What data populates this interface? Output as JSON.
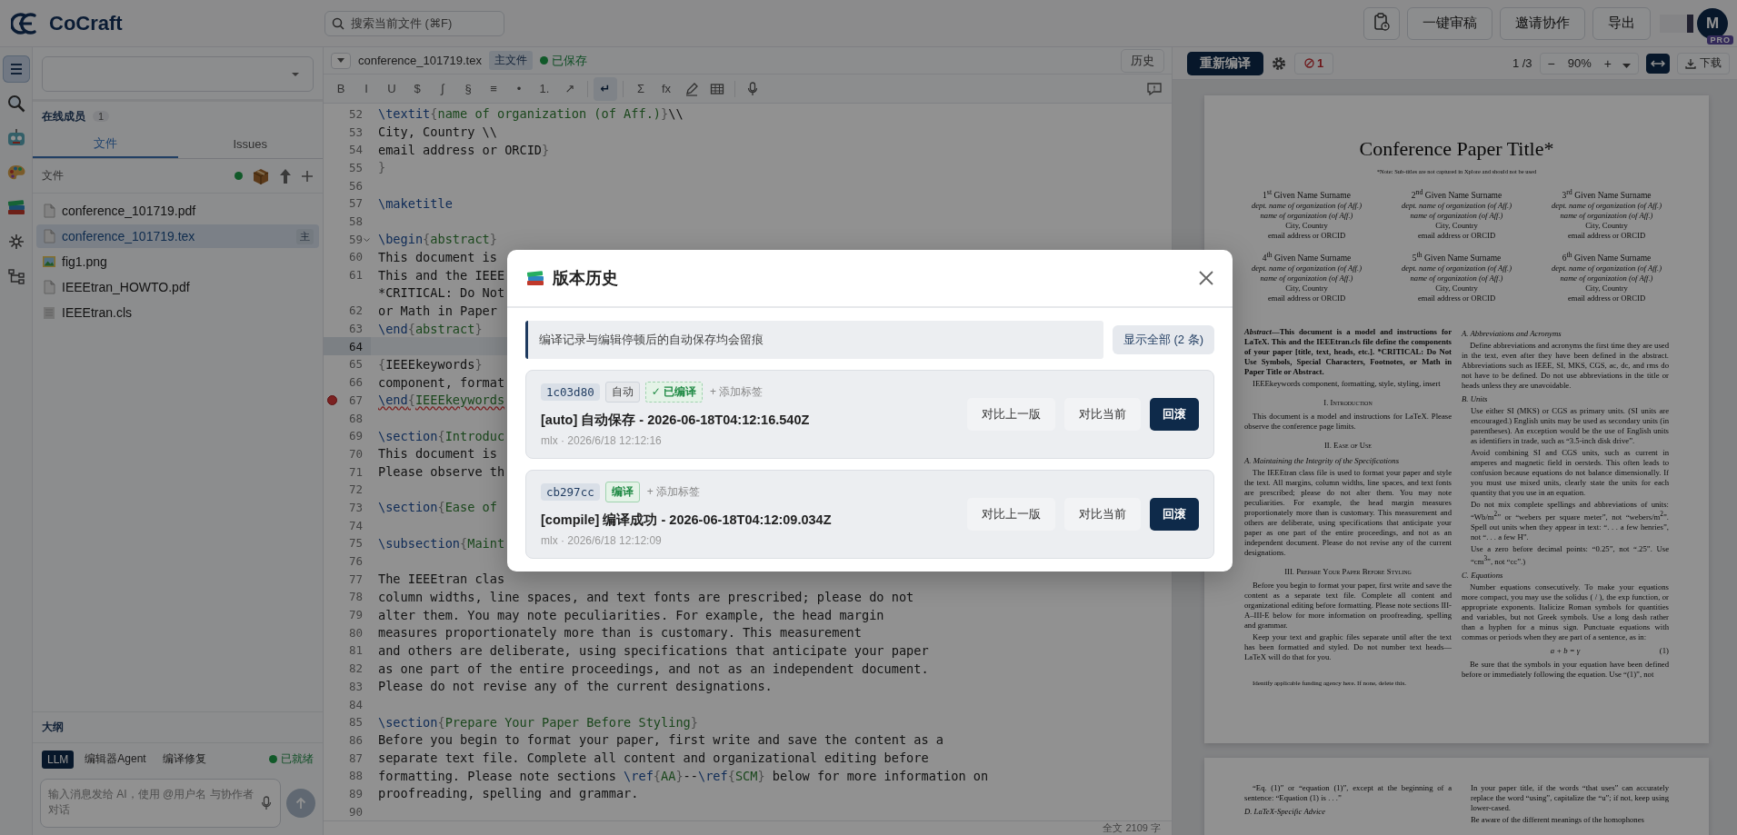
{
  "topbar": {
    "brand": "CoCraft",
    "search": {
      "placeholder": "搜索当前文件 (⌘F)"
    },
    "review_button": "一键审稿",
    "invite_button": "邀请协作",
    "export_button": "导出",
    "avatar": {
      "initial": "M",
      "badge": "PRO"
    }
  },
  "rail": [
    {
      "kind": "menu",
      "selected": true
    },
    {
      "kind": "search",
      "selected": false
    },
    {
      "kind": "robot",
      "selected": false
    },
    {
      "kind": "palette",
      "selected": false
    },
    {
      "kind": "books",
      "selected": false
    },
    {
      "kind": "sparkle",
      "selected": false
    },
    {
      "kind": "tree",
      "selected": false
    }
  ],
  "sidebar": {
    "members": {
      "label": "在线成员",
      "count": "1"
    },
    "tabs": [
      {
        "label": "文件",
        "selected": true
      },
      {
        "label": "Issues",
        "selected": false
      }
    ],
    "files_header": "文件",
    "files": [
      {
        "name": "conference_101719.pdf",
        "kind": "doc",
        "selected": false
      },
      {
        "name": "conference_101719.tex",
        "kind": "doc",
        "selected": true,
        "badge": "主"
      },
      {
        "name": "fig1.png",
        "kind": "image",
        "selected": false
      },
      {
        "name": "IEEEtran_HOWTO.pdf",
        "kind": "doc",
        "selected": false
      },
      {
        "name": "IEEEtran.cls",
        "kind": "plain",
        "selected": false
      }
    ],
    "outline_label": "大纲",
    "assistant_tabs": [
      {
        "label": "LLM",
        "selected": true
      },
      {
        "label": "编辑器Agent",
        "selected": false
      },
      {
        "label": "编译修复",
        "selected": false
      }
    ],
    "assistant_status": "已就绪",
    "chat": {
      "placeholder": "输入消息发给 AI，使用 @用户名 与协作者对话"
    }
  },
  "editor": {
    "file_name": "conference_101719.tex",
    "main_badge": "主文件",
    "save_status": "已保存",
    "history_button": "历史",
    "toolbar": [
      {
        "kind": "glyph",
        "label": "B",
        "selected": false
      },
      {
        "kind": "glyph",
        "label": "I",
        "selected": false
      },
      {
        "kind": "glyph",
        "label": "U",
        "selected": false
      },
      {
        "kind": "glyph",
        "label": "$",
        "selected": false
      },
      {
        "kind": "glyph",
        "label": "∫",
        "selected": false
      },
      {
        "kind": "glyph",
        "label": "§",
        "selected": false
      },
      {
        "kind": "glyph",
        "label": "≡",
        "selected": false
      },
      {
        "kind": "glyph",
        "label": "•",
        "selected": false
      },
      {
        "kind": "glyph",
        "label": "1.",
        "selected": false
      },
      {
        "kind": "glyph",
        "label": "↗",
        "selected": false
      },
      {
        "kind": "divider"
      },
      {
        "kind": "glyph",
        "label": "↵",
        "selected": true
      },
      {
        "kind": "divider"
      },
      {
        "kind": "glyph",
        "label": "Σ",
        "selected": false
      },
      {
        "kind": "glyph",
        "label": "fx",
        "selected": false
      },
      {
        "kind": "pen",
        "selected": false
      },
      {
        "kind": "table",
        "selected": false
      },
      {
        "kind": "divider"
      },
      {
        "kind": "mic",
        "selected": false
      }
    ],
    "lines": [
      {
        "n": "52",
        "kind": "plain",
        "text": "\\textit{name of organization (of Aff.)}\\\\"
      },
      {
        "n": "53",
        "kind": "plain",
        "text": "City, Country \\\\"
      },
      {
        "n": "54",
        "kind": "plain",
        "text": "email address or ORCID}"
      },
      {
        "n": "55",
        "kind": "plain",
        "text": "}"
      },
      {
        "n": "56",
        "kind": "plain"
      },
      {
        "n": "57",
        "kind": "plain",
        "text": "\\maketitle"
      },
      {
        "n": "58",
        "kind": "plain"
      },
      {
        "n": "59",
        "kind": "fold",
        "text": "\\begin{abstract}"
      },
      {
        "n": "60",
        "kind": "plain",
        "text": "This document is"
      },
      {
        "n": "61",
        "kind": "plain",
        "text": "This and the IEEE"
      },
      {
        "kind": "wrap",
        "text": "*CRITICAL: Do Not"
      },
      {
        "n": "62",
        "kind": "plain",
        "text": "or Math in Paper"
      },
      {
        "n": "63",
        "kind": "plain",
        "text": "\\end{abstract}"
      },
      {
        "n": "64",
        "kind": "active"
      },
      {
        "n": "65",
        "kind": "plain",
        "text": "{IEEEkeywords}"
      },
      {
        "n": "66",
        "kind": "plain",
        "text": "component, format"
      },
      {
        "n": "67",
        "kind": "error",
        "text": "\\end{IEEEkeywords"
      },
      {
        "n": "68",
        "kind": "plain"
      },
      {
        "n": "69",
        "kind": "plain",
        "text": "\\section{Introduc"
      },
      {
        "n": "70",
        "kind": "plain",
        "text": "This document is"
      },
      {
        "n": "71",
        "kind": "plain",
        "text": "Please observe th"
      },
      {
        "n": "72",
        "kind": "plain"
      },
      {
        "n": "73",
        "kind": "plain",
        "text": "\\section{Ease of"
      },
      {
        "n": "74",
        "kind": "plain"
      },
      {
        "n": "75",
        "kind": "plain",
        "text": "\\subsection{Maint"
      },
      {
        "n": "76",
        "kind": "plain"
      },
      {
        "n": "77",
        "kind": "plain",
        "text": "The IEEEtran clas"
      },
      {
        "n": "78",
        "kind": "plain",
        "text": "column widths, line spaces, and text fonts are prescribed; please do not"
      },
      {
        "n": "79",
        "kind": "plain",
        "text": "alter them. You may note peculiarities. For example, the head margin"
      },
      {
        "n": "80",
        "kind": "plain",
        "text": "measures proportionately more than is customary. This measurement"
      },
      {
        "n": "81",
        "kind": "plain",
        "text": "and others are deliberate, using specifications that anticipate your paper"
      },
      {
        "n": "82",
        "kind": "plain",
        "text": "as one part of the entire proceedings, and not as an independent document."
      },
      {
        "n": "83",
        "kind": "plain",
        "text": "Please do not revise any of the current designations."
      },
      {
        "n": "84",
        "kind": "plain"
      },
      {
        "n": "85",
        "kind": "plain",
        "text": "\\section{Prepare Your Paper Before Styling}"
      },
      {
        "n": "86",
        "kind": "plain",
        "text": "Before you begin to format your paper, first write and save the content as a"
      },
      {
        "n": "87",
        "kind": "plain",
        "text": "separate text file. Complete all content and organizational editing before"
      },
      {
        "n": "88",
        "kind": "plain",
        "text": "formatting. Please note sections \\ref{AA}--\\ref{SCM} below for more information on"
      },
      {
        "n": "89",
        "kind": "plain",
        "text": "proofreading, spelling and grammar."
      },
      {
        "n": "90",
        "kind": "plain"
      }
    ],
    "word_count": "全文 2109 字"
  },
  "preview": {
    "recompile_button": "重新编译",
    "error_count": "1",
    "page": "1",
    "page_total": "/3",
    "zoom_out": "−",
    "zoom": "90%",
    "zoom_in": "+",
    "fit_width_selected": true,
    "download_button": "下载",
    "page1": {
      "title": "Conference Paper Title*",
      "note": "*Note: Sub-titles are not captured in Xplore and should not be used",
      "authors": [
        {
          "name": "1$^{st}$ Given Name Surname",
          "dept": "dept. name of organization (of Aff.)",
          "org": "name of organization (of Aff.)",
          "city": "City, Country",
          "email": "email address or ORCID"
        },
        {
          "name": "2$^{nd}$ Given Name Surname",
          "dept": "dept. name of organization (of Aff.)",
          "org": "name of organization (of Aff.)",
          "city": "City, Country",
          "email": "email address or ORCID"
        },
        {
          "name": "3$^{rd}$ Given Name Surname",
          "dept": "dept. name of organization (of Aff.)",
          "org": "name of organization (of Aff.)",
          "city": "City, Country",
          "email": "email address or ORCID"
        },
        {
          "name": "4$^{th}$ Given Name Surname",
          "dept": "dept. name of organization (of Aff.)",
          "org": "name of organization (of Aff.)",
          "city": "City, Country",
          "email": "email address or ORCID"
        },
        {
          "name": "5$^{th}$ Given Name Surname",
          "dept": "dept. name of organization (of Aff.)",
          "org": "name of organization (of Aff.)",
          "city": "City, Country",
          "email": "email address or ORCID"
        },
        {
          "name": "6$^{th}$ Given Name Surname",
          "dept": "dept. name of organization (of Aff.)",
          "org": "name of organization (of Aff.)",
          "city": "City, Country",
          "email": "email address or ORCID"
        }
      ],
      "left": [
        {
          "kind": "abstract",
          "lead": "Abstract",
          "text": "—This document is a model and instructions for LaTeX. This and the IEEEtran.cls file define the components of your paper [title, text, heads, etc.]. *CRITICAL: Do Not Use Symbols, Special Characters, Footnotes, or Math in Paper Title or Abstract."
        },
        {
          "kind": "para",
          "text": "IEEEkeywords component, formatting, style, styling, insert"
        },
        {
          "kind": "heading",
          "text": "I. Introduction"
        },
        {
          "kind": "para",
          "text": "This document is a model and instructions for LaTeX. Please observe the conference page limits."
        },
        {
          "kind": "heading",
          "text": "II. Ease of Use"
        },
        {
          "kind": "subheading",
          "text": "A. Maintaining the Integrity of the Specifications"
        },
        {
          "kind": "para",
          "text": "The IEEEtran class file is used to format your paper and style the text. All margins, column widths, line spaces, and text fonts are prescribed; please do not alter them. You may note peculiarities. For example, the head margin measures proportionately more than is customary. This measurement and others are deliberate, using specifications that anticipate your paper as one part of the entire proceedings, and not as an independent document. Please do not revise any of the current designations."
        },
        {
          "kind": "heading",
          "text": "III. Prepare Your Paper Before Styling"
        },
        {
          "kind": "para",
          "text": "Before you begin to format your paper, first write and save the content as a separate text file. Complete all content and organizational editing before formatting. Please note sections III-A–III-E below for more information on proofreading, spelling and grammar."
        },
        {
          "kind": "para",
          "text": "Keep your text and graphic files separate until after the text has been formatted and styled. Do not number text heads—LaTeX will do that for you."
        },
        {
          "kind": "footnote",
          "text": "Identify applicable funding agency here. If none, delete this."
        }
      ],
      "right": [
        {
          "kind": "subheading",
          "text": "A. Abbreviations and Acronyms"
        },
        {
          "kind": "para",
          "text": "Define abbreviations and acronyms the first time they are used in the text, even after they have been defined in the abstract. Abbreviations such as IEEE, SI, MKS, CGS, ac, dc, and rms do not have to be defined. Do not use abbreviations in the title or heads unless they are unavoidable."
        },
        {
          "kind": "subheading",
          "text": "B. Units"
        },
        {
          "kind": "bullet",
          "text": "Use either SI (MKS) or CGS as primary units. (SI units are encouraged.) English units may be used as secondary units (in parentheses). An exception would be the use of English units as identifiers in trade, such as “3.5-inch disk drive”."
        },
        {
          "kind": "bullet",
          "text": "Avoid combining SI and CGS units, such as current in amperes and magnetic field in oersteds. This often leads to confusion because equations do not balance dimensionally. If you must use mixed units, clearly state the units for each quantity that you use in an equation."
        },
        {
          "kind": "bullet",
          "text": "Do not mix complete spellings and abbreviations of units: “Wb/m$^{2}$” or “webers per square meter”, not “webers/m$^{2}$”. Spell out units when they appear in text: “. . . a few henries”, not “. . . a few H”."
        },
        {
          "kind": "bullet",
          "text": "Use a zero before decimal points: “0.25”, not “.25”. Use “cm$^{3}$”, not “cc”.)"
        },
        {
          "kind": "subheading",
          "text": "C. Equations"
        },
        {
          "kind": "para",
          "text": "Number equations consecutively. To make your equations more compact, you may use the solidus ( / ), the exp function, or appropriate exponents. Italicize Roman symbols for quantities and variables, but not Greek symbols. Use a long dash rather than a hyphen for a minus sign. Punctuate equations with commas or periods when they are part of a sentence, as in:"
        },
        {
          "kind": "equation",
          "text": "a + b = γ",
          "number": "(1)"
        },
        {
          "kind": "para",
          "text": "Be sure that the symbols in your equation have been defined before or immediately following the equation. Use “(1)”, not"
        }
      ]
    },
    "page2": {
      "left": [
        {
          "kind": "para",
          "text": "“Eq. (1)” or “equation (1)”, except at the beginning of a sentence: “Equation (1) is . . .”"
        },
        {
          "kind": "subheading",
          "text": "D. LaTeX-Specific Advice"
        }
      ],
      "right": [
        {
          "kind": "bullet",
          "text": "In your paper title, if the words “that uses” can accurately replace the word “using”, capitalize the “u”; if not, keep using lower-cased."
        },
        {
          "kind": "bullet",
          "text": "Be aware of the different meanings of the homophones"
        }
      ]
    }
  },
  "version_history": {
    "title": "版本历史",
    "notice": "编译记录与编辑停顿后的自动保存均会留痕",
    "show_all_button": "显示全部 (2 条)",
    "versions": [
      {
        "hash": "1c03d80",
        "tags": [
          {
            "label": "自动",
            "kind": "auto"
          },
          {
            "label": "✓ 已编译",
            "kind": "compiled"
          }
        ],
        "add_tag": "+ 添加标签",
        "message": "[auto] 自动保存 - 2026-06-18T04:12:16.540Z",
        "meta": "mlx · 2026/6/18 12:12:16",
        "compare_prev": "对比上一版",
        "compare_current": "对比当前",
        "rollback": "回滚"
      },
      {
        "hash": "cb297cc",
        "tags": [
          {
            "label": "编译",
            "kind": "compile"
          }
        ],
        "add_tag": "+ 添加标签",
        "message": "[compile] 编译成功 - 2026-06-18T04:12:09.034Z",
        "meta": "mlx · 2026/6/18 12:12:09",
        "compare_prev": "对比上一版",
        "compare_current": "对比当前",
        "rollback": "回滚"
      }
    ]
  }
}
